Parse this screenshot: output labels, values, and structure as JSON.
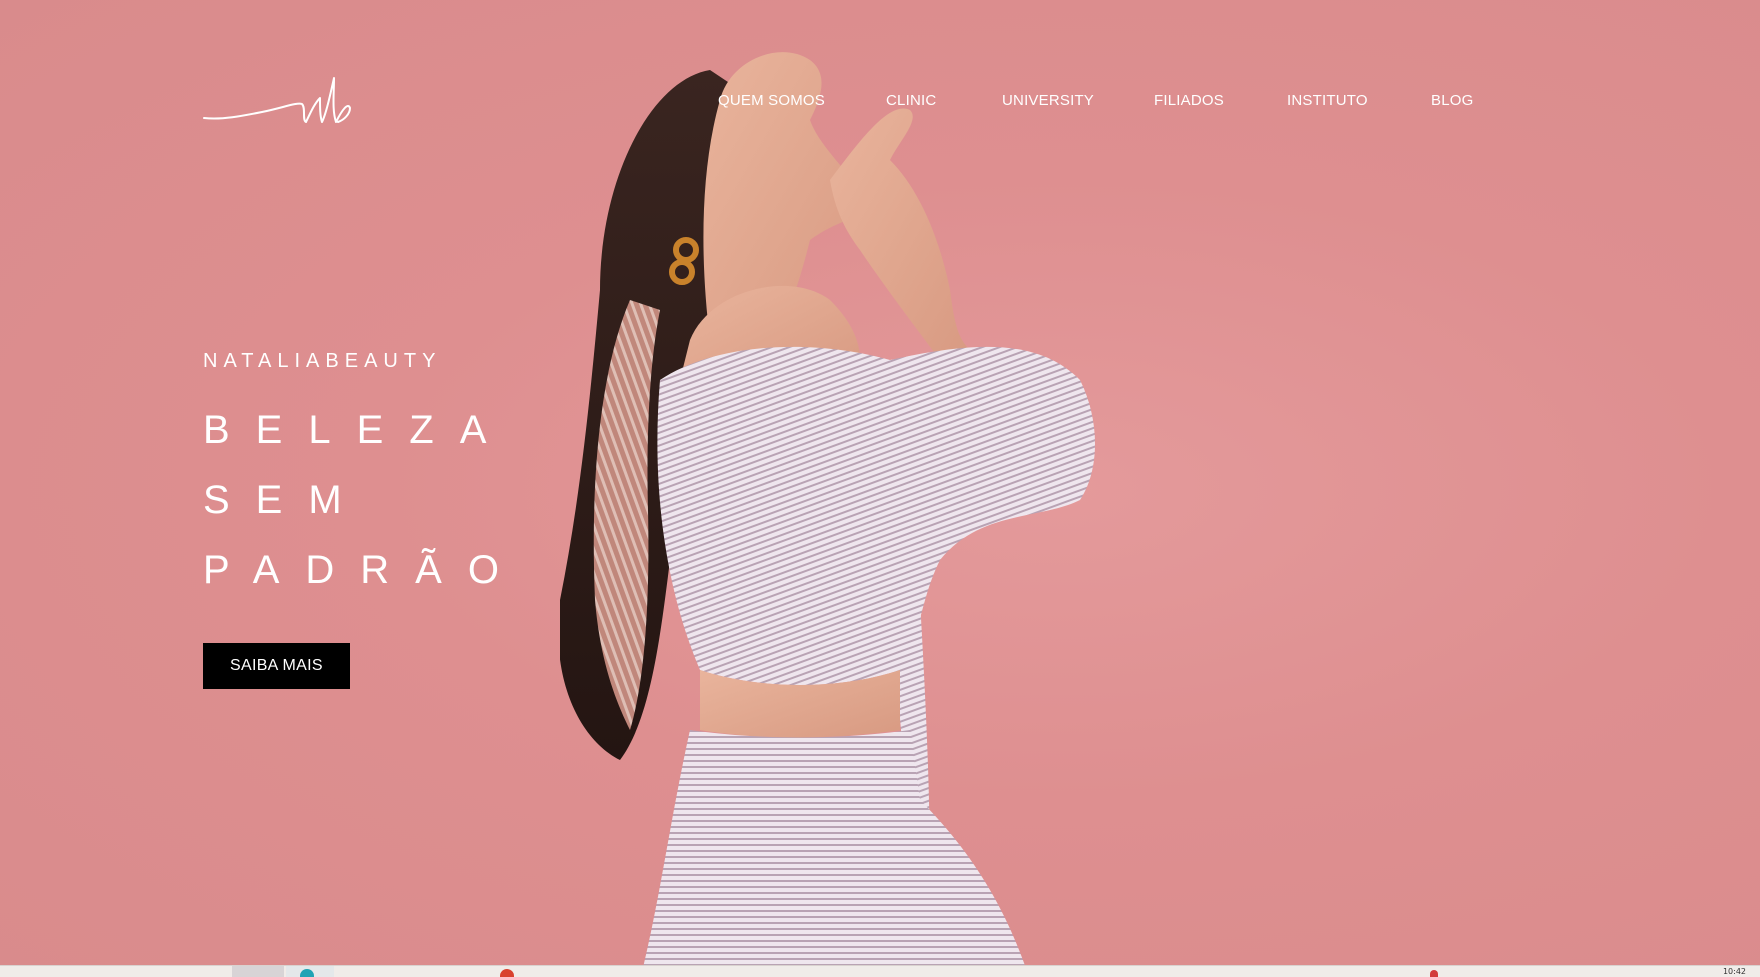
{
  "logo": {
    "icon": "signature-logo-icon",
    "color": "#ffffff"
  },
  "nav": {
    "items": [
      {
        "label": "QUEM SOMOS"
      },
      {
        "label": "CLINIC"
      },
      {
        "label": "UNIVERSITY"
      },
      {
        "label": "FILIADOS"
      },
      {
        "label": "INSTITUTO"
      },
      {
        "label": "BLOG"
      }
    ]
  },
  "hero": {
    "brand": "NATALIABEAUTY",
    "headline": [
      "BELEZA",
      "SEM",
      "PADRÃO"
    ],
    "cta_label": "SAIBA MAIS"
  },
  "taskbar": {
    "time": "10:42"
  },
  "colors": {
    "background": "#df9091",
    "text": "#ffffff",
    "cta_background": "#000000"
  }
}
